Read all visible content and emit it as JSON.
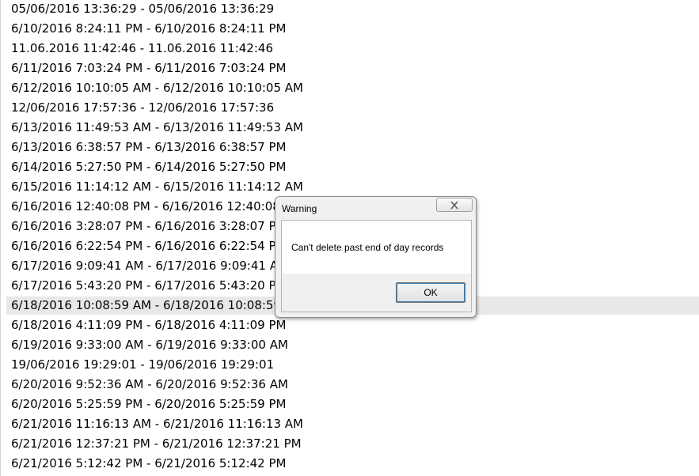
{
  "records": [
    {
      "text": "05/06/2016 13:36:29 - 05/06/2016 13:36:29"
    },
    {
      "text": "6/10/2016 8:24:11 PM - 6/10/2016 8:24:11 PM"
    },
    {
      "text": "11.06.2016 11:42:46 - 11.06.2016 11:42:46"
    },
    {
      "text": "6/11/2016 7:03:24 PM - 6/11/2016 7:03:24 PM"
    },
    {
      "text": "6/12/2016 10:10:05 AM - 6/12/2016 10:10:05 AM"
    },
    {
      "text": "12/06/2016 17:57:36 - 12/06/2016 17:57:36"
    },
    {
      "text": "6/13/2016 11:49:53 AM - 6/13/2016 11:49:53 AM"
    },
    {
      "text": "6/13/2016 6:38:57 PM - 6/13/2016 6:38:57 PM"
    },
    {
      "text": "6/14/2016 5:27:50 PM - 6/14/2016 5:27:50 PM"
    },
    {
      "text": "6/15/2016 11:14:12 AM - 6/15/2016 11:14:12 AM"
    },
    {
      "text": "6/16/2016 12:40:08 PM - 6/16/2016 12:40:08 PM"
    },
    {
      "text": "6/16/2016 3:28:07 PM - 6/16/2016 3:28:07 PM"
    },
    {
      "text": "6/16/2016 6:22:54 PM - 6/16/2016 6:22:54 PM"
    },
    {
      "text": "6/17/2016 9:09:41 AM - 6/17/2016 9:09:41 AM"
    },
    {
      "text": "6/17/2016 5:43:20 PM - 6/17/2016 5:43:20 PM"
    },
    {
      "text": "6/18/2016 10:08:59 AM - 6/18/2016 10:08:59 AM",
      "selected": true
    },
    {
      "text": "6/18/2016 4:11:09 PM - 6/18/2016 4:11:09 PM"
    },
    {
      "text": "6/19/2016 9:33:00 AM - 6/19/2016 9:33:00 AM"
    },
    {
      "text": "19/06/2016 19:29:01 - 19/06/2016 19:29:01"
    },
    {
      "text": "6/20/2016 9:52:36 AM - 6/20/2016 9:52:36 AM"
    },
    {
      "text": "6/20/2016 5:25:59 PM - 6/20/2016 5:25:59 PM"
    },
    {
      "text": "6/21/2016 11:16:13 AM - 6/21/2016 11:16:13 AM"
    },
    {
      "text": "6/21/2016 12:37:21 PM - 6/21/2016 12:37:21 PM"
    },
    {
      "text": "6/21/2016 5:12:42 PM - 6/21/2016 5:12:42 PM"
    }
  ],
  "dialog": {
    "title": "Warning",
    "message": "Can't delete past end of day records",
    "ok_label": "OK",
    "close_icon": "close-x-icon"
  },
  "colors": {
    "selected_row": "#e8e8e8",
    "dialog_bg": "#f0f0f0",
    "ok_focus": "#3c7fb1"
  }
}
